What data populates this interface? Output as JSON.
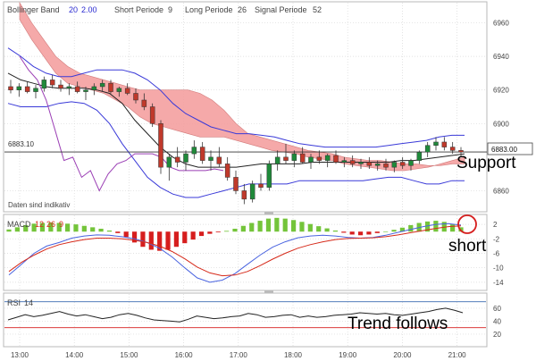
{
  "header": {
    "bollinger_label": "Bollinger Band",
    "bollinger_p1": "20",
    "bollinger_p2": "2.00",
    "ichimoku_short": "Short Periode",
    "ichimoku_short_val": "9",
    "ichimoku_long": "Long Periode",
    "ichimoku_long_val": "26",
    "ichimoku_signal": "Signal Periode",
    "ichimoku_signal_val": "52"
  },
  "annotations": {
    "support": "Support",
    "short": "short",
    "trend": "Trend follows",
    "data_note": "Daten sind indikativ",
    "price_line_left": "6883.10",
    "price_line_right": "6883.00"
  },
  "macd_label": {
    "name": "MACD",
    "fast": "12",
    "slow": "26",
    "signal": "9"
  },
  "rsi_label": {
    "name": "RSI",
    "period": "14"
  },
  "colors": {
    "cloud": "#f4a0a0",
    "bull_candle": "#1f8a3a",
    "bear_candle": "#c0392b",
    "bollinger": "#3a3ad8",
    "sma": "#222222",
    "base_line": "#9b3fb5",
    "macd_line": "#4a64e0",
    "signal_line": "#d62a1a",
    "hist_pos": "#74c43a",
    "hist_neg": "#d61e1e",
    "annotation_circle": "#d61e1e"
  },
  "chart_data": [
    {
      "type": "candlestick",
      "panel": "price",
      "x_ticks": [
        "13:00",
        "14:00",
        "15:00",
        "16:00",
        "17:00",
        "18:00",
        "19:00",
        "20:00",
        "21:00"
      ],
      "y_ticks": [
        6960,
        6940,
        6920,
        6900,
        6883,
        6860
      ],
      "ylim": [
        6848,
        6972
      ],
      "candles": [
        [
          6922,
          6926,
          6918,
          6920
        ],
        [
          6920,
          6924,
          6916,
          6922
        ],
        [
          6922,
          6925,
          6918,
          6919
        ],
        [
          6919,
          6923,
          6915,
          6921
        ],
        [
          6921,
          6928,
          6919,
          6926
        ],
        [
          6926,
          6929,
          6921,
          6923
        ],
        [
          6923,
          6926,
          6919,
          6921
        ],
        [
          6921,
          6924,
          6917,
          6922
        ],
        [
          6922,
          6925,
          6918,
          6919
        ],
        [
          6919,
          6922,
          6914,
          6920
        ],
        [
          6920,
          6924,
          6917,
          6922
        ],
        [
          6922,
          6926,
          6919,
          6924
        ],
        [
          6924,
          6926,
          6918,
          6919
        ],
        [
          6919,
          6922,
          6916,
          6921
        ],
        [
          6921,
          6924,
          6917,
          6918
        ],
        [
          6918,
          6921,
          6912,
          6914
        ],
        [
          6914,
          6918,
          6908,
          6910
        ],
        [
          6910,
          6912,
          6898,
          6900
        ],
        [
          6900,
          6902,
          6870,
          6874
        ],
        [
          6874,
          6882,
          6866,
          6880
        ],
        [
          6880,
          6886,
          6874,
          6877
        ],
        [
          6877,
          6884,
          6872,
          6882
        ],
        [
          6882,
          6890,
          6879,
          6886
        ],
        [
          6886,
          6889,
          6876,
          6878
        ],
        [
          6878,
          6884,
          6872,
          6880
        ],
        [
          6880,
          6886,
          6874,
          6876
        ],
        [
          6876,
          6880,
          6866,
          6868
        ],
        [
          6868,
          6872,
          6858,
          6860
        ],
        [
          6860,
          6864,
          6852,
          6855
        ],
        [
          6855,
          6866,
          6853,
          6864
        ],
        [
          6864,
          6870,
          6860,
          6862
        ],
        [
          6862,
          6878,
          6860,
          6876
        ],
        [
          6876,
          6884,
          6872,
          6880
        ],
        [
          6880,
          6888,
          6876,
          6878
        ],
        [
          6878,
          6884,
          6874,
          6882
        ],
        [
          6882,
          6886,
          6876,
          6877
        ],
        [
          6877,
          6882,
          6873,
          6880
        ],
        [
          6880,
          6884,
          6876,
          6878
        ],
        [
          6878,
          6882,
          6874,
          6881
        ],
        [
          6881,
          6884,
          6876,
          6877
        ],
        [
          6877,
          6880,
          6874,
          6878
        ],
        [
          6878,
          6881,
          6874,
          6876
        ],
        [
          6876,
          6879,
          6873,
          6877
        ],
        [
          6877,
          6880,
          6873,
          6875
        ],
        [
          6875,
          6878,
          6872,
          6876
        ],
        [
          6876,
          6879,
          6872,
          6874
        ],
        [
          6874,
          6878,
          6871,
          6877
        ],
        [
          6877,
          6880,
          6873,
          6875
        ],
        [
          6875,
          6879,
          6872,
          6878
        ],
        [
          6878,
          6884,
          6876,
          6883
        ],
        [
          6883,
          6889,
          6880,
          6887
        ],
        [
          6887,
          6892,
          6884,
          6889
        ],
        [
          6889,
          6892,
          6884,
          6886
        ],
        [
          6886,
          6889,
          6882,
          6884
        ],
        [
          6884,
          6886,
          6880,
          6883
        ]
      ],
      "cloud_upper": [
        6972,
        6960,
        6950,
        6940,
        6934,
        6930,
        6928,
        6926,
        6924,
        6922,
        6920,
        6920,
        6920,
        6920,
        6920,
        6918,
        6914,
        6908,
        6900,
        6894,
        6892,
        6890,
        6888,
        6886,
        6884,
        6883,
        6882,
        6880,
        6879,
        6878,
        6878,
        6877,
        6876,
        6876,
        6875,
        6875,
        6876,
        6876
      ],
      "cloud_lower": [
        6962,
        6950,
        6940,
        6930,
        6924,
        6922,
        6920,
        6918,
        6914,
        6910,
        6904,
        6900,
        6898,
        6896,
        6894,
        6892,
        6892,
        6892,
        6890,
        6888,
        6886,
        6884,
        6883,
        6882,
        6880,
        6879,
        6878,
        6876,
        6875,
        6874,
        6873,
        6872,
        6872,
        6873,
        6874,
        6876,
        6878,
        6880
      ],
      "bollinger_upper": [
        6945,
        6940,
        6934,
        6930,
        6928,
        6928,
        6930,
        6932,
        6932,
        6932,
        6930,
        6926,
        6920,
        6912,
        6906,
        6902,
        6898,
        6896,
        6894,
        6894,
        6893,
        6892,
        6890,
        6888,
        6887,
        6886,
        6886,
        6886,
        6886,
        6886,
        6887,
        6888,
        6889,
        6890,
        6892,
        6893,
        6893
      ],
      "bollinger_lower": [
        6912,
        6910,
        6910,
        6910,
        6912,
        6913,
        6912,
        6908,
        6900,
        6888,
        6878,
        6868,
        6862,
        6858,
        6856,
        6856,
        6858,
        6860,
        6862,
        6864,
        6864,
        6864,
        6864,
        6866,
        6866,
        6866,
        6866,
        6866,
        6866,
        6867,
        6868,
        6868,
        6866,
        6864,
        6864,
        6866,
        6866
      ],
      "sma": [
        6930,
        6926,
        6924,
        6922,
        6921,
        6921,
        6921,
        6920,
        6918,
        6912,
        6902,
        6894,
        6886,
        6880,
        6876,
        6874,
        6874,
        6874,
        6874,
        6875,
        6876,
        6876,
        6876,
        6876,
        6877,
        6877,
        6877,
        6877,
        6877,
        6877,
        6877,
        6878,
        6878,
        6879,
        6880,
        6881,
        6882
      ],
      "base_line": [
        6940,
        6932,
        6926,
        6914,
        6896,
        6878,
        6880,
        6868,
        6872,
        6860,
        6870,
        6876,
        6878,
        6882,
        6882,
        6882,
        6880,
        6874,
        6872,
        6872,
        6872,
        6872,
        6873,
        6872
      ],
      "price_line": 6883.1
    },
    {
      "type": "macd",
      "panel": "macd",
      "y_ticks": [
        2,
        -2,
        -6,
        -10,
        -14
      ],
      "ylim": [
        -16,
        4.5
      ],
      "histogram": [
        0.6,
        1.2,
        1.8,
        2.2,
        2.4,
        2.5,
        2.4,
        2.2,
        2.0,
        1.6,
        1.2,
        0.8,
        0.3,
        -0.4,
        -1.5,
        -3.0,
        -4.2,
        -5.0,
        -5.3,
        -5.0,
        -4.2,
        -3.2,
        -2.2,
        -1.2,
        -0.6,
        -0.2,
        0.2,
        0.8,
        1.6,
        2.4,
        3.0,
        3.6,
        3.8,
        3.6,
        3.2,
        2.7,
        2.1,
        1.5,
        0.9,
        0.3,
        -0.3,
        -0.8,
        -1.0,
        -0.8,
        -0.4,
        0,
        0.5,
        1.1,
        1.8,
        2.4,
        2.8,
        3.0,
        2.7,
        2.0,
        1.2
      ],
      "macd": [
        -12,
        -9,
        -6,
        -4,
        -3,
        -1.8,
        -1.2,
        -0.9,
        -1.0,
        -1.4,
        -2.0,
        -3.0,
        -4.6,
        -7.0,
        -10.0,
        -12.8,
        -14.0,
        -13.4,
        -11.6,
        -9.0,
        -6.5,
        -4.3,
        -2.8,
        -1.7,
        -1.2,
        -1.0,
        -1.2,
        -1.6,
        -1.8,
        -1.6,
        -1.0,
        -0.2,
        0.6,
        1.4,
        2.0,
        2.2,
        1.8
      ],
      "signal": [
        -11,
        -8.5,
        -6.5,
        -4.8,
        -3.6,
        -2.8,
        -2.2,
        -1.8,
        -1.8,
        -2.0,
        -2.4,
        -3.0,
        -4.0,
        -5.5,
        -7.5,
        -9.8,
        -11.4,
        -12.2,
        -12.0,
        -11.0,
        -9.4,
        -7.6,
        -6.0,
        -4.6,
        -3.6,
        -2.8,
        -2.2,
        -1.9,
        -1.8,
        -1.7,
        -1.4,
        -0.9,
        -0.3,
        0.3,
        0.9,
        1.4,
        1.6
      ]
    },
    {
      "type": "line",
      "panel": "rsi",
      "y_ticks": [
        60,
        40,
        20
      ],
      "ylim": [
        2,
        82
      ],
      "upper_level": 70,
      "lower_level": 30,
      "values": [
        42,
        46,
        50,
        47,
        49,
        52,
        55,
        51,
        48,
        50,
        47,
        44,
        46,
        50,
        52,
        49,
        45,
        42,
        41,
        40,
        39,
        43,
        48,
        46,
        44,
        45,
        47,
        48,
        52,
        50,
        46,
        47,
        49,
        50,
        46,
        48,
        46,
        47,
        49,
        50,
        51,
        53,
        52,
        51,
        52,
        50,
        49,
        51,
        53,
        55,
        58,
        60,
        57,
        53
      ]
    }
  ]
}
